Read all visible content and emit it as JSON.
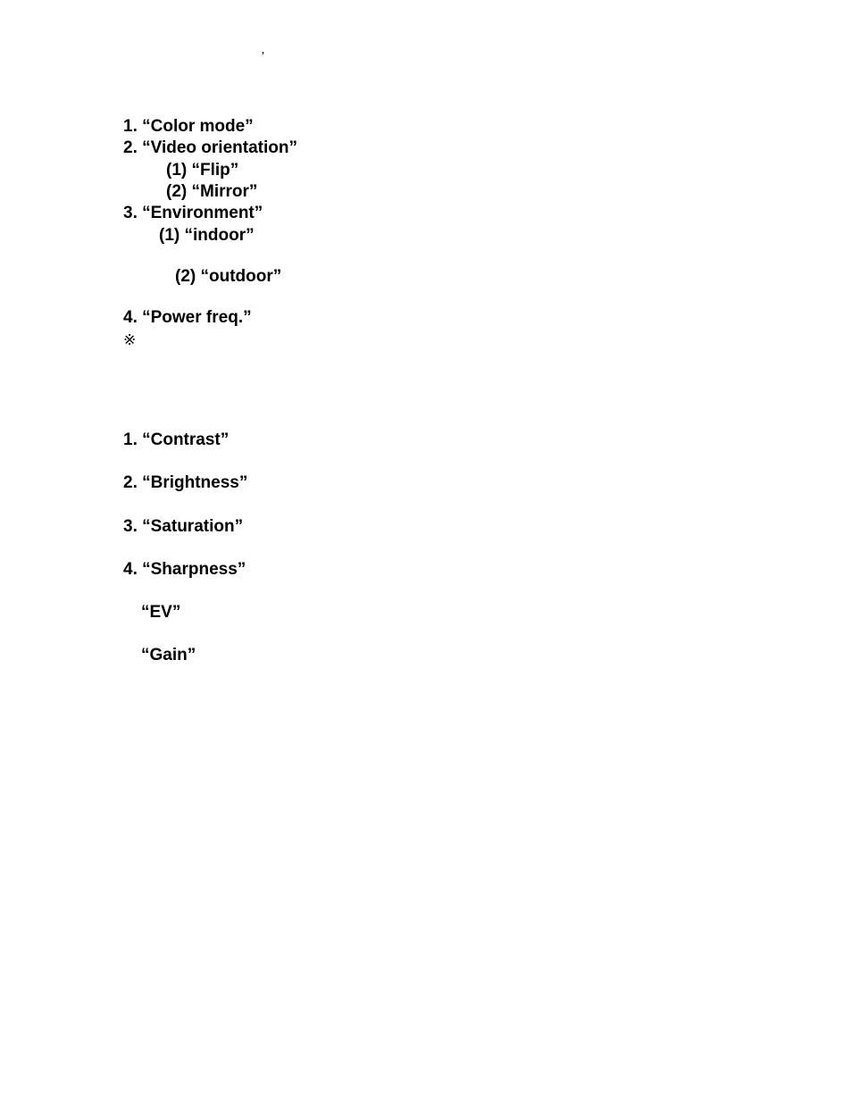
{
  "topmark": "’",
  "section1": {
    "item1": "1. “Color mode”",
    "item2": "2. “Video orientation”",
    "item2_sub1": "(1) “Flip”",
    "item2_sub2": "(2) “Mirror”",
    "item3": "3. “Environment”",
    "item3_sub1": "(1) “indoor”",
    "item3_sub2": "(2) “outdoor”",
    "item4": "4. “Power freq.”",
    "note_mark": "※"
  },
  "section2": {
    "item1": "1. “Contrast”",
    "item2": "2. “Brightness”",
    "item3": "3. “Saturation”",
    "item4": "4. “Sharpness”",
    "item5": "“EV”",
    "item6": "“Gain”"
  }
}
